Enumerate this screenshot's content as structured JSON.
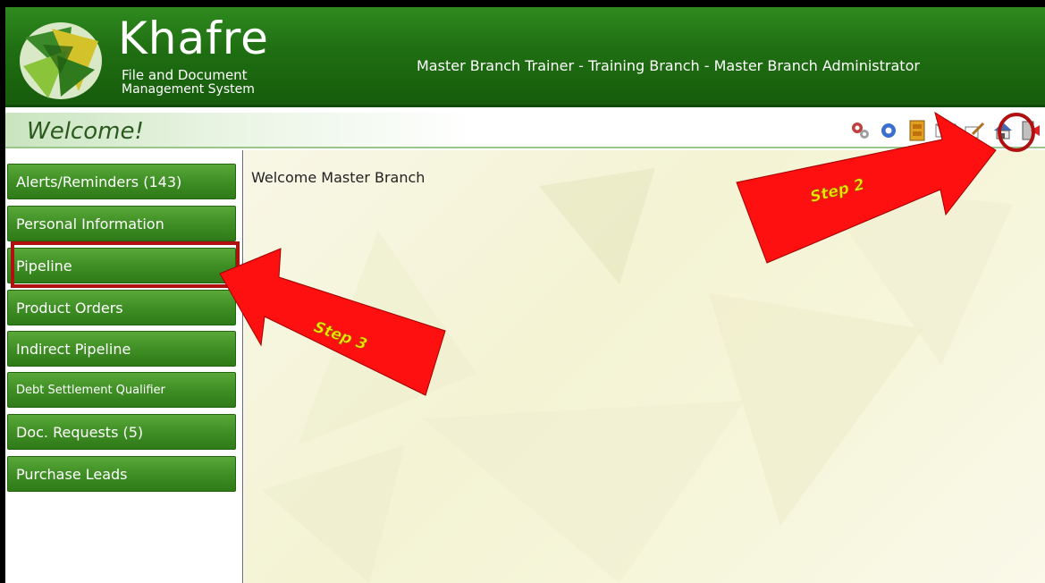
{
  "app": {
    "brand_name": "Khafre",
    "brand_sub_line1": "File and Document",
    "brand_sub_line2": "Management System",
    "user_info": "Master Branch Trainer - Training Branch - Master Branch Administrator"
  },
  "welcome_bar": {
    "title": "Welcome!",
    "toolbar_icons": [
      "settings-gears-icon",
      "settings-gear-icon",
      "cabinet-icon",
      "mail-icon",
      "edit-icon",
      "home-icon",
      "logout-icon"
    ]
  },
  "sidebar": {
    "items": [
      {
        "label": "Alerts/Reminders (143)"
      },
      {
        "label": "Personal Information"
      },
      {
        "label": "Pipeline"
      },
      {
        "label": "Product Orders"
      },
      {
        "label": "Indirect Pipeline"
      },
      {
        "label": "Debt Settlement Qualifier"
      },
      {
        "label": "Doc. Requests (5)"
      },
      {
        "label": "Purchase Leads"
      }
    ]
  },
  "main": {
    "welcome_message": "Welcome Master Branch"
  },
  "annotations": {
    "step2_label": "Step 2",
    "step3_label": "Step 3",
    "arrow_color": "#ff1010",
    "highlight_color": "#b01010"
  },
  "colors": {
    "header_green": "#1f6e12",
    "button_green": "#3f8f25",
    "welcome_text": "#2a5a1e"
  }
}
